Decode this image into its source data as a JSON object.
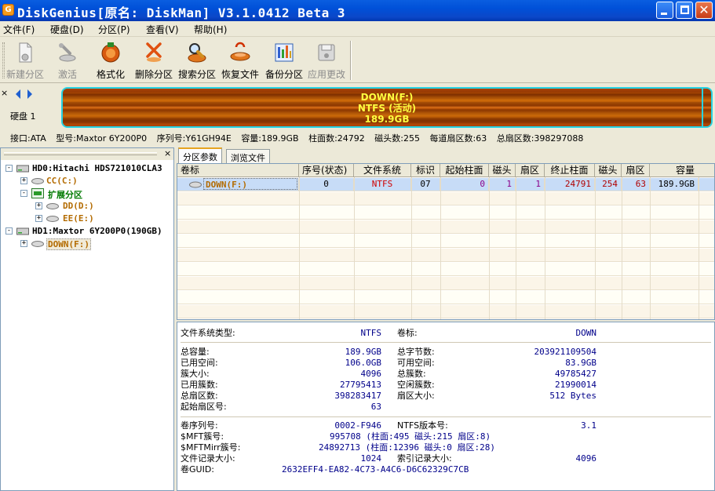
{
  "window": {
    "title": "DiskGenius[原名: DiskMan] V3.1.0412 Beta 3",
    "icon_letter": "G"
  },
  "menu": [
    "文件(F)",
    "硬盘(D)",
    "分区(P)",
    "查看(V)",
    "帮助(H)"
  ],
  "toolbar": [
    {
      "label": "新建分区",
      "icon": "new-partition-icon",
      "enabled": false
    },
    {
      "label": "激活",
      "icon": "activate-icon",
      "enabled": false
    },
    {
      "label": "格式化",
      "icon": "format-icon",
      "enabled": true
    },
    {
      "label": "删除分区",
      "icon": "delete-partition-icon",
      "enabled": true
    },
    {
      "label": "搜索分区",
      "icon": "search-partition-icon",
      "enabled": true
    },
    {
      "label": "恢复文件",
      "icon": "recover-files-icon",
      "enabled": true
    },
    {
      "label": "备份分区",
      "icon": "backup-partition-icon",
      "enabled": true
    },
    {
      "label": "应用更改",
      "icon": "apply-changes-icon",
      "enabled": false
    }
  ],
  "disk": {
    "label": "硬盘 1",
    "partition_bar": {
      "name": "DOWN(F:)",
      "fs": "NTFS (活动)",
      "size": "189.9GB"
    },
    "info": [
      "接口:ATA",
      "型号:Maxtor 6Y200P0",
      "序列号:Y61GH94E",
      "容量:189.9GB",
      "柱面数:24792",
      "磁头数:255",
      "每道扇区数:63",
      "总扇区数:398297088"
    ]
  },
  "tree": [
    {
      "label": "HD0:Hitachi HDS721010CLA3",
      "expander": "-",
      "icon": "hard-disk-icon"
    },
    {
      "label": "CC(C:)",
      "expander": "+",
      "icon": "partition-icon"
    },
    {
      "label": "扩展分区",
      "expander": "-",
      "icon": "extended-partition-icon"
    },
    {
      "label": "DD(D:)",
      "expander": "+",
      "icon": "partition-icon"
    },
    {
      "label": "EE(E:)",
      "expander": "+",
      "icon": "partition-icon"
    },
    {
      "label": "HD1:Maxtor 6Y200P0(190GB)",
      "expander": "-",
      "icon": "hard-disk-icon"
    },
    {
      "label": "DOWN(F:)",
      "expander": "+",
      "icon": "partition-icon"
    }
  ],
  "tabs": [
    "分区参数",
    "浏览文件"
  ],
  "grid": {
    "headers": [
      "卷标",
      "序号(状态)",
      "文件系统",
      "标识",
      "起始柱面",
      "磁头",
      "扇区",
      "终止柱面",
      "磁头",
      "扇区",
      "容量"
    ],
    "row": [
      "DOWN(F:)",
      "0",
      "NTFS",
      "07",
      "0",
      "1",
      "1",
      "24791",
      "254",
      "63",
      "189.9GB"
    ]
  },
  "fs": {
    "type_label": "文件系统类型:",
    "type_value": "NTFS",
    "vol_label": "卷标:",
    "vol_value": "DOWN"
  },
  "stats": {
    "left": [
      {
        "label": "总容量:",
        "value": "189.9GB"
      },
      {
        "label": "已用空间:",
        "value": "106.0GB"
      },
      {
        "label": "簇大小:",
        "value": "4096"
      },
      {
        "label": "已用簇数:",
        "value": "27795413"
      },
      {
        "label": "总扇区数:",
        "value": "398283417"
      },
      {
        "label": "起始扇区号:",
        "value": "63"
      }
    ],
    "right": [
      {
        "label": "总字节数:",
        "value": "203921109504"
      },
      {
        "label": "可用空间:",
        "value": "83.9GB"
      },
      {
        "label": "总簇数:",
        "value": "49785427"
      },
      {
        "label": "空闲簇数:",
        "value": "21990014"
      },
      {
        "label": "扇区大小:",
        "value": "512 Bytes"
      }
    ]
  },
  "ntfs": {
    "serial_label": "卷序列号:",
    "serial_value": "0002-F946",
    "ver_label": "NTFS版本号:",
    "ver_value": "3.1",
    "mft_label": "$MFT簇号:",
    "mft_value": "995708 (柱面:495 磁头:215 扇区:8)",
    "mftmirr_label": "$MFTMirr簇号:",
    "mftmirr_value": "24892713 (柱面:12396 磁头:0 扇区:28)",
    "frs_label": "文件记录大小:",
    "frs_value": "1024",
    "irs_label": "索引记录大小:",
    "irs_value": "4096",
    "guid_label": "卷GUID:",
    "guid_value": "2632EFF4-EA82-4C73-A4C6-D6C62329C7CB"
  },
  "colors": {
    "titlebar": "#0050d8",
    "partition_bar": "#b9460a",
    "partition_border": "#27d3e3",
    "partition_text": "#ffff40",
    "value_text": "#00008a"
  }
}
